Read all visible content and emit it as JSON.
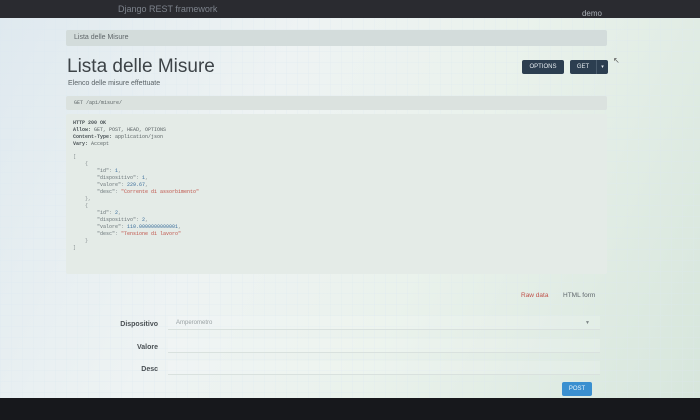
{
  "topbar": {
    "brand": "Django REST framework",
    "user": "demo"
  },
  "breadcrumb": "Lista delle Misure",
  "page": {
    "title": "Lista delle Misure",
    "subtitle": "Elenco delle misure effettuate"
  },
  "buttons": {
    "options": "OPTIONS",
    "get": "GET",
    "get_caret": "▾",
    "post": "POST"
  },
  "request_line": "GET /api/misure/",
  "response": {
    "status": "HTTP 200 OK",
    "headers": [
      {
        "name": "Allow:",
        "value": " GET, POST, HEAD, OPTIONS"
      },
      {
        "name": "Content-Type:",
        "value": " application/json"
      },
      {
        "name": "Vary:",
        "value": " Accept"
      }
    ],
    "records": [
      {
        "id": "1",
        "dispositivo": "1",
        "valore": "229.67",
        "desc": "\"Corrente di assorbimento\""
      },
      {
        "id": "2",
        "dispositivo": "2",
        "valore": "110.0000000000001",
        "desc": "\"Tensione di lavoro\""
      }
    ]
  },
  "formats": {
    "raw": "Raw data",
    "html": "HTML form"
  },
  "form": {
    "dispositivo_label": "Dispositivo",
    "dispositivo_value": "Amperometro",
    "valore_label": "Valore",
    "desc_label": "Desc"
  }
}
